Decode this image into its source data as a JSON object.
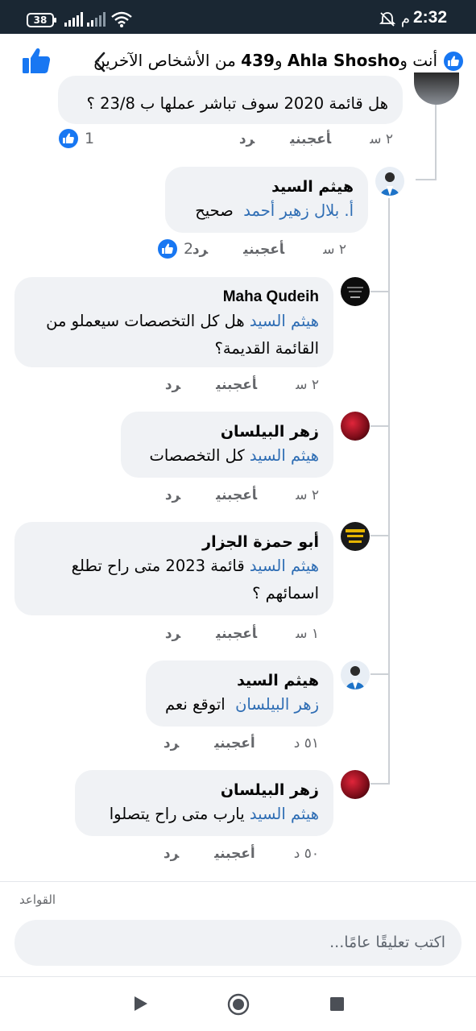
{
  "status_bar": {
    "battery": "38",
    "time": "2:32",
    "ampm": "م"
  },
  "header": {
    "prefix": "أنت و",
    "name": "Ahla Shosho",
    "middle": " و",
    "count": "439",
    "suffix": " من الأشخاص الآخرين"
  },
  "comments": [
    {
      "body": "هل قائمة 2020 سوف تباشر عملها ب 23/8 ؟",
      "time": "٢ س",
      "like": "أعجبني",
      "reply": "رد",
      "likes": "1"
    },
    {
      "author": "هيثم السيد",
      "mention": "أ. بلال زهير أحمد",
      "body": "صحيح",
      "time": "٢ س",
      "like": "أعجبني",
      "reply": "رد",
      "likes": "2"
    },
    {
      "author": "Maha Qudeih",
      "mention": "هيثم السيد",
      "body": "هل كل التخصصات سيعملو من القائمة القديمة؟",
      "time": "٢ س",
      "like": "أعجبني",
      "reply": "رد"
    },
    {
      "author": "زهر البيلسان",
      "mention": "هيثم السيد",
      "body": "كل التخصصات",
      "time": "٢ س",
      "like": "أعجبني",
      "reply": "رد"
    },
    {
      "author": "أبو حمزة الجزار",
      "mention": "هيثم السيد",
      "body": "قائمة 2023 متى راح تطلع اسمائهم ؟",
      "time": "١ س",
      "like": "أعجبني",
      "reply": "رد"
    },
    {
      "author": "هيثم السيد",
      "mention": "زهر البيلسان",
      "body": "اتوقع نعم",
      "time": "٥١ د",
      "like": "أعجبني",
      "reply": "رد"
    },
    {
      "author": "زهر البيلسان",
      "mention": "هيثم السيد",
      "body": "يارب متى راح يتصلوا",
      "time": "٥٠ د",
      "like": "أعجبني",
      "reply": "رد"
    }
  ],
  "footer": {
    "rules": "القواعد",
    "composer_placeholder": "اكتب تعليقًا عامًا..."
  },
  "colors": {
    "status_bar": "#1a2733",
    "facebook_blue": "#1877f2",
    "mention": "#2e6db4",
    "bubble": "#f0f2f5"
  },
  "icons": {
    "header_like": "thumbs-up-icon",
    "back": "chevron-left-icon",
    "nav_back": "play-triangle-icon",
    "nav_home": "circle-home-icon",
    "nav_recent": "square-recent-icon"
  }
}
